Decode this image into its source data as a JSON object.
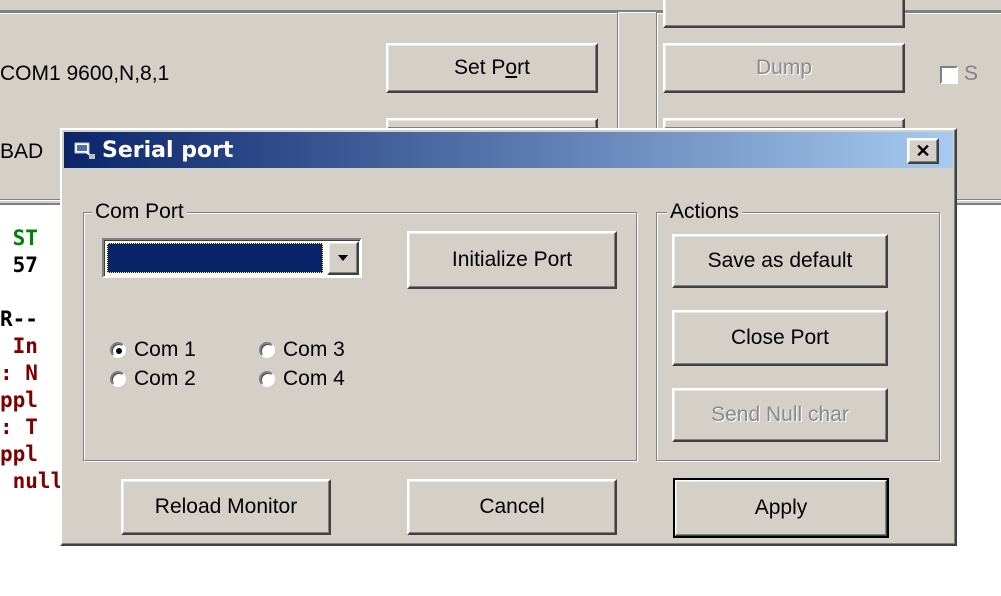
{
  "background_window": {
    "port_settings": "COM1 9600,N,8,1",
    "set_port_label_pre": "Set P",
    "set_port_label_hot": "o",
    "set_port_label_post": "rt",
    "dump_label": "Dump",
    "partial_checkbox_label": "S",
    "partial_status_text": "BAD",
    "console_lines": [
      {
        "text": " ST",
        "color": "#008000"
      },
      {
        "text": " 57",
        "color": "#000000"
      },
      {
        "text": "",
        "color": "#000000"
      },
      {
        "text": "R--",
        "color": "#000000"
      },
      {
        "text": " In",
        "color": "#800000"
      },
      {
        "text": ": N",
        "color": "#800000"
      },
      {
        "text": "ppl",
        "color": "#800000"
      },
      {
        "text": ": T",
        "color": "#800000"
      },
      {
        "text": "ppl",
        "color": "#800000"
      },
      {
        "text": " null. No baudrate available",
        "color": "#800000"
      }
    ]
  },
  "dialog": {
    "title": "Serial port",
    "close_glyph": "✕",
    "com_port_group": {
      "legend": "Com Port",
      "selected_value": "",
      "radios": [
        {
          "label": "Com 1",
          "checked": true
        },
        {
          "label": "Com 3",
          "checked": false
        },
        {
          "label": "Com 2",
          "checked": false
        },
        {
          "label": "Com 4",
          "checked": false
        }
      ]
    },
    "initialize_port_label": "Initialize Port",
    "actions_group": {
      "legend": "Actions",
      "save_default_label": "Save as default",
      "close_port_label": "Close Port",
      "send_null_label": "Send Null char"
    },
    "reload_monitor_label": "Reload Monitor",
    "cancel_label": "Cancel",
    "apply_label": "Apply"
  },
  "colors": {
    "title_gradient_start": "#0a246a",
    "title_gradient_end": "#a6caf0",
    "face": "#d4d0c8",
    "selection": "#0a246a"
  }
}
